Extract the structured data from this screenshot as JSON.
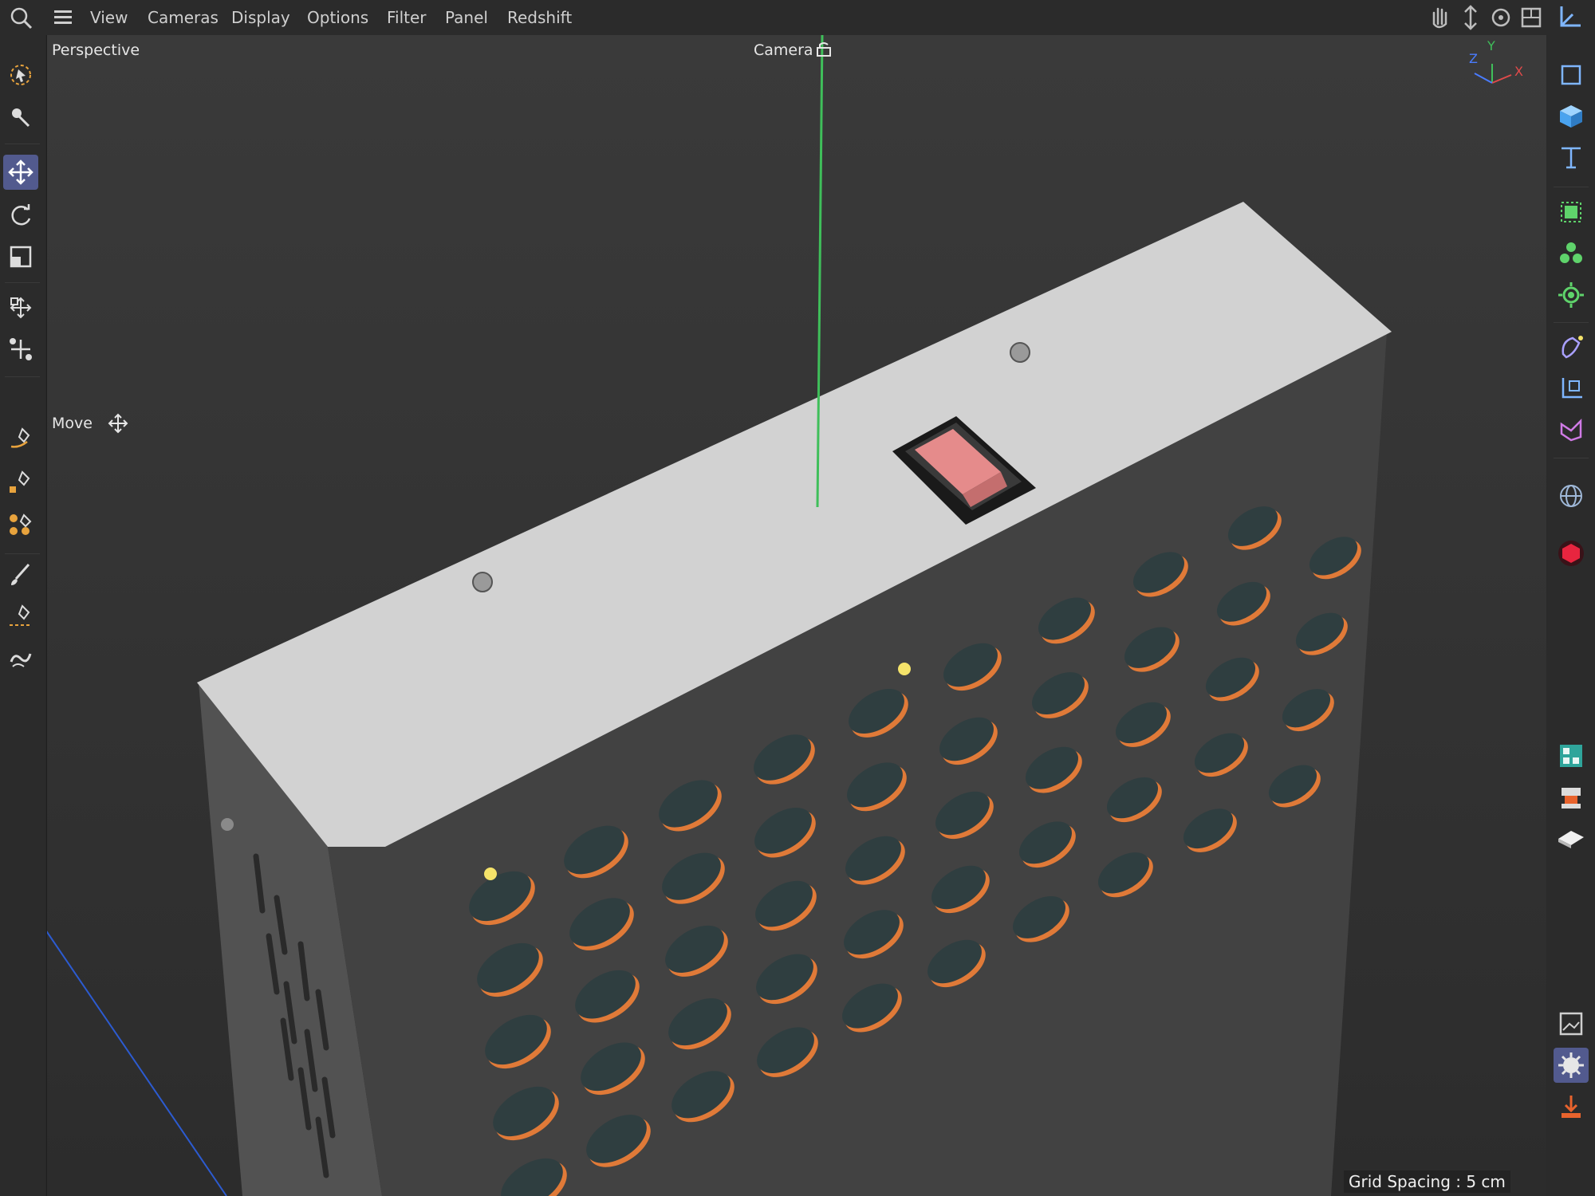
{
  "menu": {
    "items": [
      {
        "label": "View"
      },
      {
        "label": "Cameras"
      },
      {
        "label": "Display"
      },
      {
        "label": "Options"
      },
      {
        "label": "Filter"
      },
      {
        "label": "Panel"
      },
      {
        "label": "Redshift"
      }
    ]
  },
  "viewport": {
    "view_name": "Perspective",
    "camera_label": "Camera",
    "tool_label": "Move",
    "grid_spacing": "Grid Spacing : 5 cm",
    "axis_labels": {
      "z": "Z",
      "y": "Y",
      "x": "X"
    }
  },
  "icons": {
    "left": [
      "live-selection-icon",
      "tweak-icon",
      "move-icon",
      "rotate-icon",
      "scale-icon",
      "transfer-icon",
      "snap-icon",
      "spline-pen-icon",
      "spline-sketch-icon",
      "spline-smooth-icon",
      "brush-icon",
      "knife-icon",
      "magnet-icon"
    ],
    "right": [
      "null-object-icon",
      "cube-icon",
      "text-icon",
      "cloner-icon",
      "mograph-icon",
      "effector-icon",
      "deformer-icon",
      "generator-icon",
      "field-icon",
      "environment-icon",
      "redshift-icon",
      "object-manager-icon",
      "layer-icon",
      "floor-icon",
      "render-view-icon",
      "render-settings-icon",
      "render-icon"
    ]
  },
  "colors": {
    "accent": "#525a8e",
    "y_axis": "#3fbf5a",
    "switch": "#e58b8b",
    "hole_rim": "#e07a38",
    "led": "#f5e36a"
  }
}
